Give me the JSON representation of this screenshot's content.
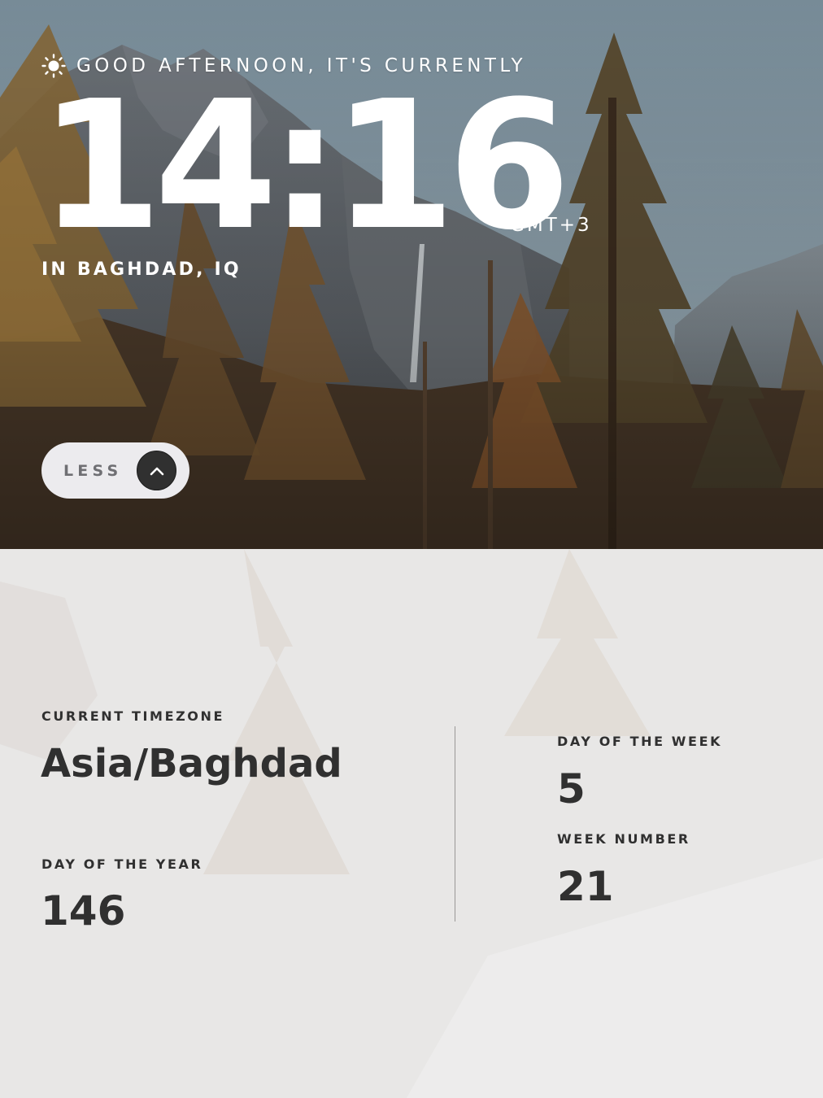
{
  "hero": {
    "greeting": "GOOD AFTERNOON, IT'S CURRENTLY",
    "greeting_icon": "sun-icon",
    "time": "14:16",
    "timezone_abbreviation": "GMT+3",
    "location": "IN BAGHDAD, IQ",
    "toggle": {
      "label": "LESS",
      "icon": "chevron-up-icon"
    }
  },
  "details": {
    "current_timezone": {
      "label": "CURRENT TIMEZONE",
      "value": "Asia/Baghdad"
    },
    "day_of_year": {
      "label": "DAY OF THE YEAR",
      "value": "146"
    },
    "day_of_week": {
      "label": "DAY OF THE WEEK",
      "value": "5"
    },
    "week_number": {
      "label": "WEEK NUMBER",
      "value": "21"
    }
  },
  "colors": {
    "hero_text": "#ffffff",
    "panel_text": "#303030",
    "panel_background": "#e8e7e6",
    "toggle_background": "#ecebee",
    "toggle_circle": "#303030",
    "toggle_label": "#6f6f73"
  }
}
